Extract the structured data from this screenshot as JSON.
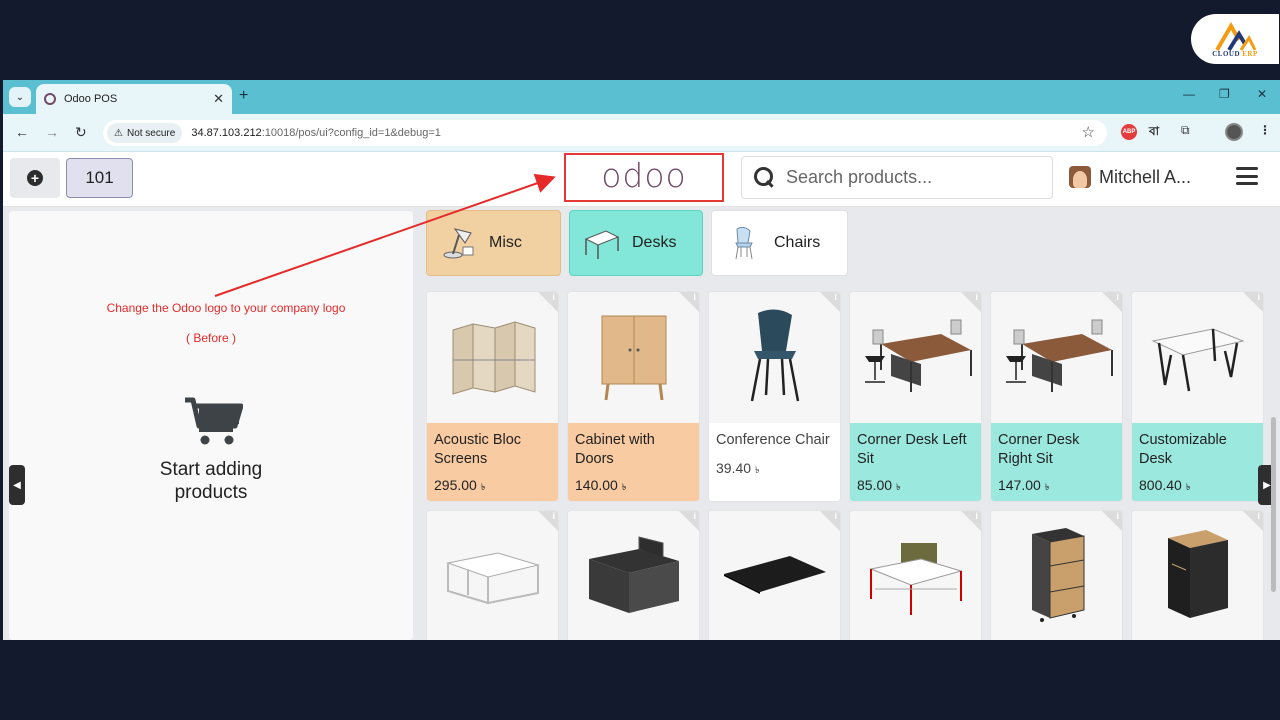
{
  "brand": {
    "text_main": "CLOUD ",
    "text_accent": "ERP"
  },
  "browser": {
    "tab_title": "Odoo POS",
    "url_host": "34.87.103.212",
    "url_rest": ":10018/pos/ui?config_id=1&debug=1",
    "not_secure": "Not secure",
    "ext_bangla": "বা"
  },
  "pos": {
    "order_number": "101",
    "logo": "odoo",
    "search_placeholder": "Search products...",
    "user_name": "Mitchell A..."
  },
  "annotation": {
    "note": "Change the Odoo logo to your company logo",
    "before": "( Before )",
    "arrow_color": "#e62a2a"
  },
  "cart": {
    "empty_line1": "Start adding",
    "empty_line2": "products"
  },
  "categories": [
    {
      "label": "Misc",
      "color": "#f1d0a2",
      "icon": "lamp-icon"
    },
    {
      "label": "Desks",
      "color": "#82e6d8",
      "icon": "desk-icon"
    },
    {
      "label": "Chairs",
      "color": "#ffffff",
      "icon": "chair-icon"
    }
  ],
  "currency": "৳",
  "products": [
    {
      "name": "Acoustic Bloc Screens",
      "price": "295.00",
      "style": "orange",
      "icon": "screen-icon"
    },
    {
      "name": "Cabinet with Doors",
      "price": "140.00",
      "style": "orange",
      "icon": "cabinet-icon"
    },
    {
      "name": "Conference Chair",
      "price": "39.40",
      "style": "white",
      "icon": "chair-icon"
    },
    {
      "name": "Corner Desk Left Sit",
      "price": "85.00",
      "style": "teal",
      "icon": "corner-desk-icon"
    },
    {
      "name": "Corner Desk Right Sit",
      "price": "147.00",
      "style": "teal",
      "icon": "corner-desk-icon"
    },
    {
      "name": "Customizable Desk",
      "price": "800.40",
      "style": "teal",
      "icon": "table-icon"
    },
    {
      "name": "",
      "price": "",
      "style": "white",
      "icon": "desk-frame-icon"
    },
    {
      "name": "",
      "price": "",
      "style": "white",
      "icon": "organizer-icon"
    },
    {
      "name": "",
      "price": "",
      "style": "white",
      "icon": "desk-pad-icon"
    },
    {
      "name": "",
      "price": "",
      "style": "white",
      "icon": "workstation-icon"
    },
    {
      "name": "",
      "price": "",
      "style": "white",
      "icon": "drawer-icon"
    },
    {
      "name": "",
      "price": "",
      "style": "white",
      "icon": "pedestal-icon"
    }
  ]
}
